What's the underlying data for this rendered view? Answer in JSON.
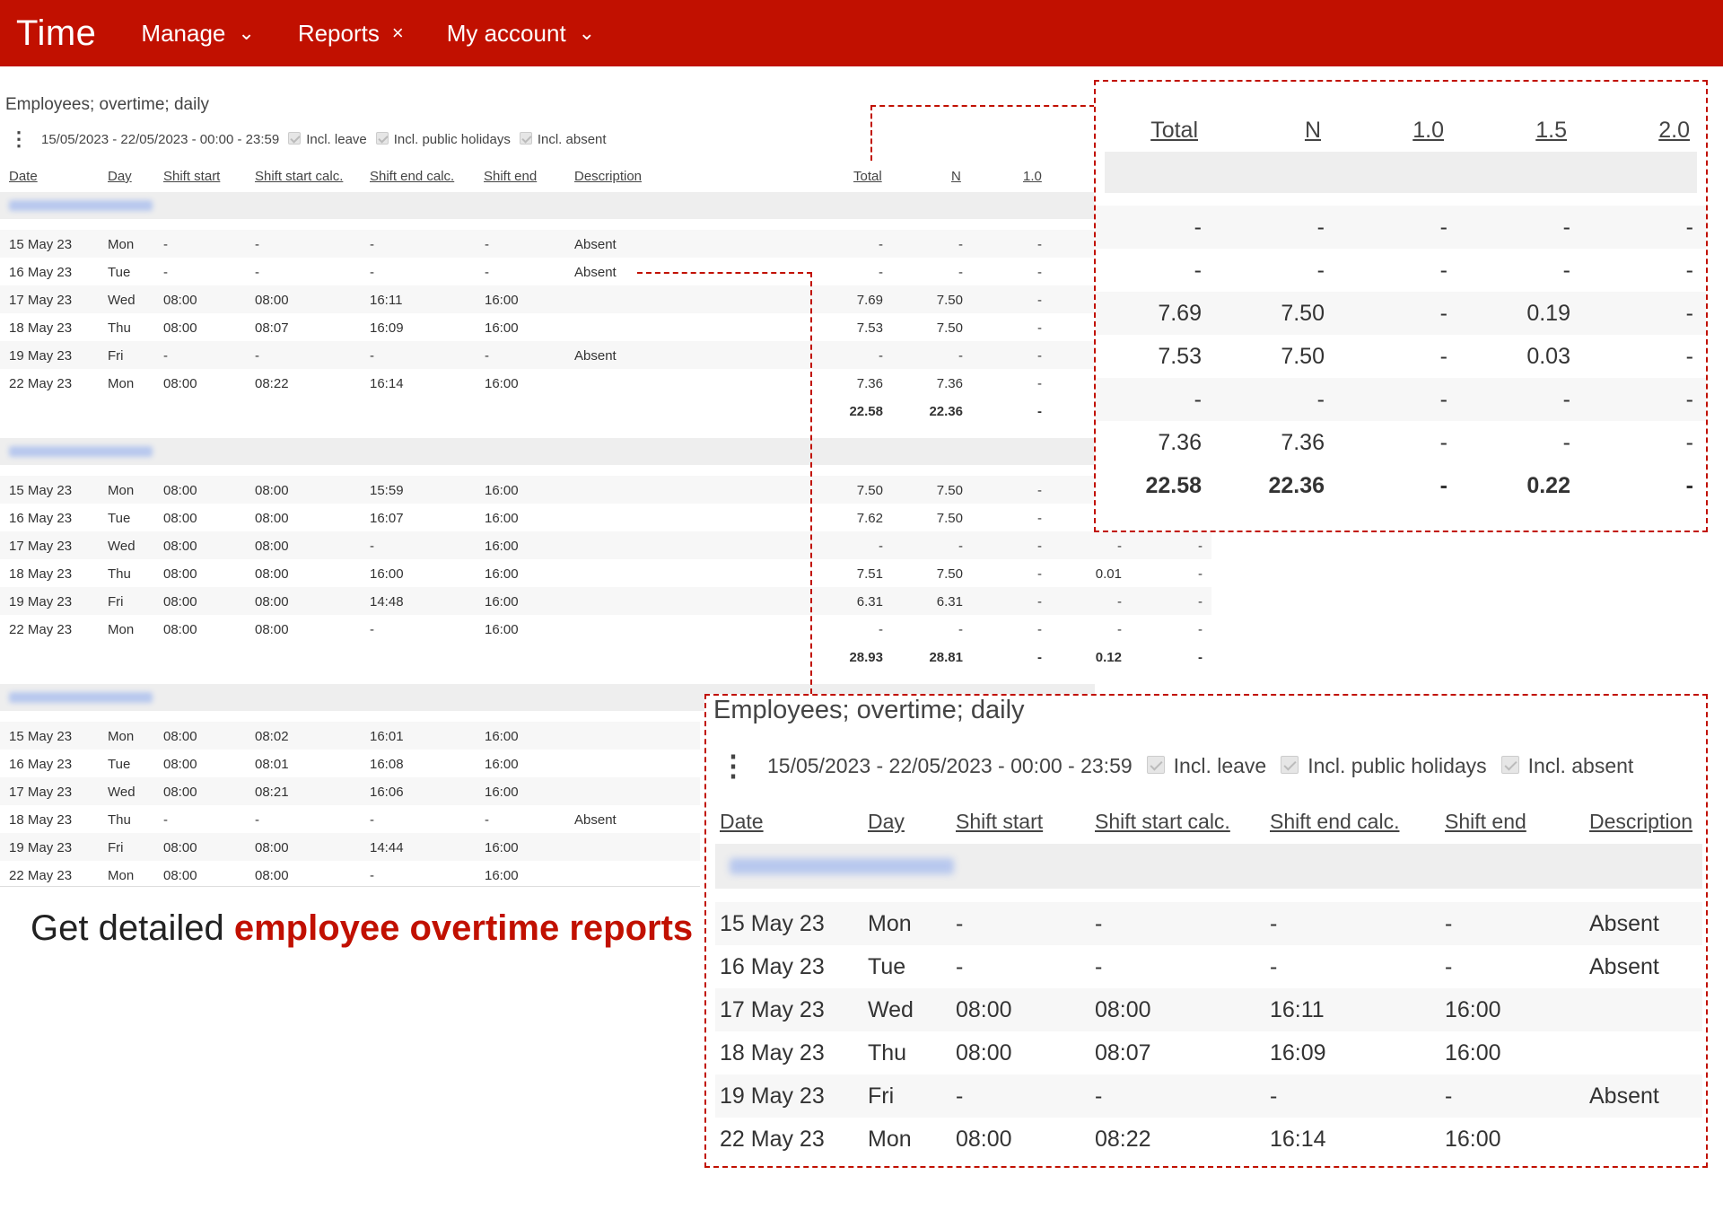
{
  "nav": {
    "brand": "Time",
    "items": [
      {
        "label": "Manage",
        "icon": "chevron-down-icon",
        "glyph": "⌄"
      },
      {
        "label": "Reports",
        "icon": "close-icon",
        "glyph": "×"
      },
      {
        "label": "My account",
        "icon": "chevron-down-icon",
        "glyph": "⌄"
      }
    ]
  },
  "report": {
    "title": "Employees; overtime; daily",
    "date_range": "15/05/2023 - 22/05/2023 - 00:00 - 23:59",
    "filters": [
      "Incl. leave",
      "Incl. public holidays",
      "Incl. absent"
    ],
    "columns": [
      "Date",
      "Day",
      "Shift start",
      "Shift start calc.",
      "Shift end calc.",
      "Shift end",
      "Description",
      "Total",
      "N",
      "1.0"
    ],
    "groups": [
      {
        "rows": [
          [
            "15 May 23",
            "Mon",
            "-",
            "-",
            "-",
            "-",
            "Absent",
            "-",
            "-",
            "-"
          ],
          [
            "16 May 23",
            "Tue",
            "-",
            "-",
            "-",
            "-",
            "Absent",
            "-",
            "-",
            "-"
          ],
          [
            "17 May 23",
            "Wed",
            "08:00",
            "08:00",
            "16:11",
            "16:00",
            "",
            "7.69",
            "7.50",
            "-"
          ],
          [
            "18 May 23",
            "Thu",
            "08:00",
            "08:07",
            "16:09",
            "16:00",
            "",
            "7.53",
            "7.50",
            "-"
          ],
          [
            "19 May 23",
            "Fri",
            "-",
            "-",
            "-",
            "-",
            "Absent",
            "-",
            "-",
            "-"
          ],
          [
            "22 May 23",
            "Mon",
            "08:00",
            "08:22",
            "16:14",
            "16:00",
            "",
            "7.36",
            "7.36",
            "-"
          ]
        ],
        "totals": [
          "22.58",
          "22.36",
          "-"
        ]
      },
      {
        "rows": [
          [
            "15 May 23",
            "Mon",
            "08:00",
            "08:00",
            "15:59",
            "16:00",
            "",
            "7.50",
            "7.50",
            "-",
            "",
            ""
          ],
          [
            "16 May 23",
            "Tue",
            "08:00",
            "08:00",
            "16:07",
            "16:00",
            "",
            "7.62",
            "7.50",
            "-",
            "",
            ""
          ],
          [
            "17 May 23",
            "Wed",
            "08:00",
            "08:00",
            "-",
            "16:00",
            "",
            "-",
            "-",
            "-",
            "-",
            "-"
          ],
          [
            "18 May 23",
            "Thu",
            "08:00",
            "08:00",
            "16:00",
            "16:00",
            "",
            "7.51",
            "7.50",
            "-",
            "0.01",
            "-"
          ],
          [
            "19 May 23",
            "Fri",
            "08:00",
            "08:00",
            "14:48",
            "16:00",
            "",
            "6.31",
            "6.31",
            "-",
            "-",
            "-"
          ],
          [
            "22 May 23",
            "Mon",
            "08:00",
            "08:00",
            "-",
            "16:00",
            "",
            "-",
            "-",
            "-",
            "-",
            "-"
          ]
        ],
        "totals": [
          "28.93",
          "28.81",
          "-",
          "0.12",
          "-"
        ]
      },
      {
        "rows": [
          [
            "15 May 23",
            "Mon",
            "08:00",
            "08:02",
            "16:01",
            "16:00",
            ""
          ],
          [
            "16 May 23",
            "Tue",
            "08:00",
            "08:01",
            "16:08",
            "16:00",
            ""
          ],
          [
            "17 May 23",
            "Wed",
            "08:00",
            "08:21",
            "16:06",
            "16:00",
            ""
          ],
          [
            "18 May 23",
            "Thu",
            "-",
            "-",
            "-",
            "-",
            "Absent"
          ],
          [
            "19 May 23",
            "Fri",
            "08:00",
            "08:00",
            "14:44",
            "16:00",
            ""
          ],
          [
            "22 May 23",
            "Mon",
            "08:00",
            "08:00",
            "-",
            "16:00",
            ""
          ]
        ]
      }
    ]
  },
  "zoom_totals": {
    "columns": [
      "Total",
      "N",
      "1.0",
      "1.5",
      "2.0"
    ],
    "rows": [
      [
        "-",
        "-",
        "-",
        "-",
        "-"
      ],
      [
        "-",
        "-",
        "-",
        "-",
        "-"
      ],
      [
        "7.69",
        "7.50",
        "-",
        "0.19",
        "-"
      ],
      [
        "7.53",
        "7.50",
        "-",
        "0.03",
        "-"
      ],
      [
        "-",
        "-",
        "-",
        "-",
        "-"
      ],
      [
        "7.36",
        "7.36",
        "-",
        "-",
        "-"
      ]
    ],
    "totals": [
      "22.58",
      "22.36",
      "-",
      "0.22",
      "-"
    ]
  },
  "zoom_detail": {
    "title": "Employees; overtime; daily",
    "date_range": "15/05/2023 - 22/05/2023 - 00:00 - 23:59",
    "filters": [
      "Incl. leave",
      "Incl. public holidays",
      "Incl. absent"
    ],
    "columns": [
      "Date",
      "Day",
      "Shift start",
      "Shift start calc.",
      "Shift end calc.",
      "Shift end",
      "Description"
    ],
    "rows": [
      [
        "15 May 23",
        "Mon",
        "-",
        "-",
        "-",
        "-",
        "Absent"
      ],
      [
        "16 May 23",
        "Tue",
        "-",
        "-",
        "-",
        "-",
        "Absent"
      ],
      [
        "17 May 23",
        "Wed",
        "08:00",
        "08:00",
        "16:11",
        "16:00",
        ""
      ],
      [
        "18 May 23",
        "Thu",
        "08:00",
        "08:07",
        "16:09",
        "16:00",
        ""
      ],
      [
        "19 May 23",
        "Fri",
        "-",
        "-",
        "-",
        "-",
        "Absent"
      ],
      [
        "22 May 23",
        "Mon",
        "08:00",
        "08:22",
        "16:14",
        "16:00",
        ""
      ]
    ]
  },
  "headline": {
    "prefix": "Get detailed ",
    "highlight": "employee overtime reports"
  },
  "colors": {
    "brand": "#c11000"
  }
}
